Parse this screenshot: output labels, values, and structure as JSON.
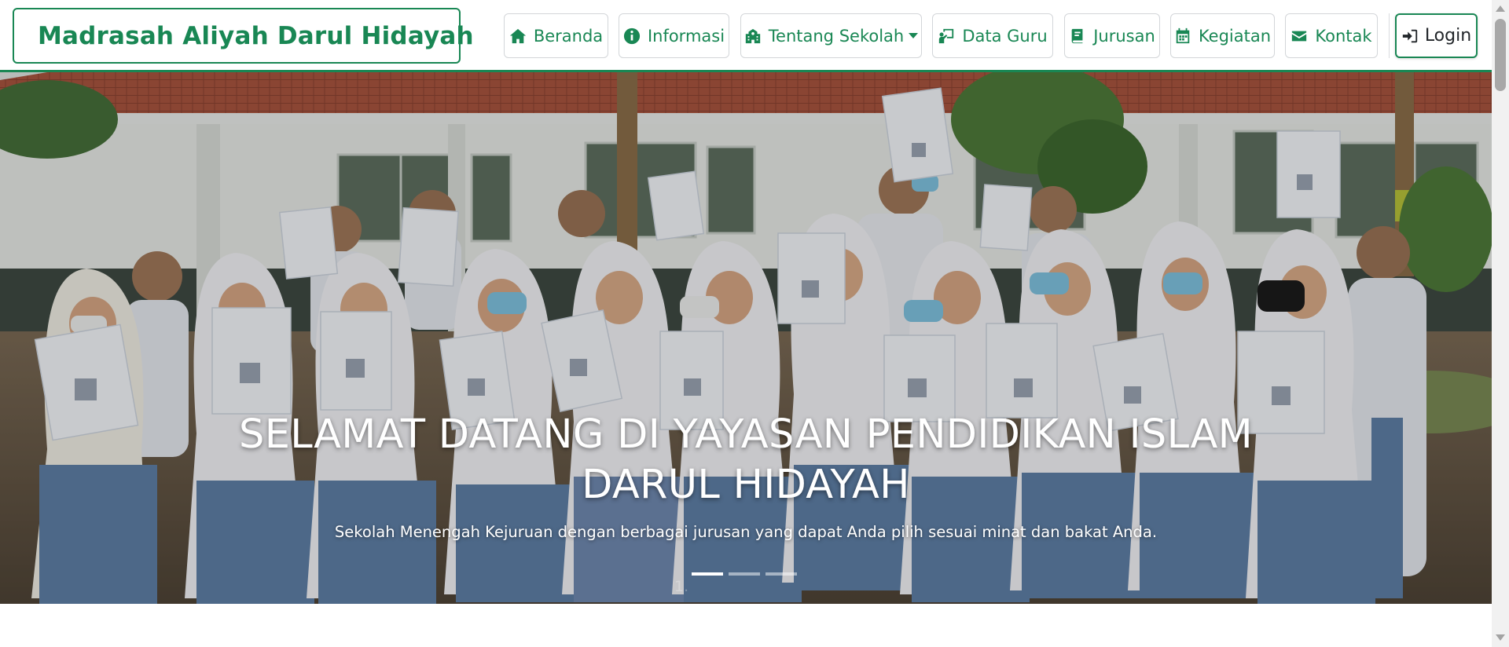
{
  "brand": {
    "name": "Madrasah Aliyah Darul Hidayah",
    "logo_icon": "madrasah-emblem-icon",
    "color": "#198754"
  },
  "nav": {
    "items": [
      {
        "label": "Beranda",
        "icon": "home-icon"
      },
      {
        "label": "Informasi",
        "icon": "info-circle-icon"
      },
      {
        "label": "Tentang Sekolah",
        "icon": "school-icon",
        "dropdown": true
      },
      {
        "label": "Data Guru",
        "icon": "teacher-icon"
      },
      {
        "label": "Jurusan",
        "icon": "book-icon"
      },
      {
        "label": "Kegiatan",
        "icon": "calendar-icon"
      },
      {
        "label": "Kontak",
        "icon": "envelope-icon"
      }
    ],
    "login_label": "Login",
    "login_icon": "sign-in-icon"
  },
  "hero": {
    "title": "SELAMAT DATANG DI YAYASAN PENDIDIKAN ISLAM DARUL HIDAYAH",
    "subtitle": "Sekolah Menengah Kejuruan dengan berbagai jurusan yang dapat Anda pilih sesuai minat dan bakat Anda.",
    "slide_count": 3,
    "active_slide": 1,
    "faded_number": "1."
  },
  "colors": {
    "accent": "#198754",
    "roof": "#a9553f",
    "uniform_skirt": "#5f7fa7",
    "uniform_top": "#eef0f4"
  }
}
